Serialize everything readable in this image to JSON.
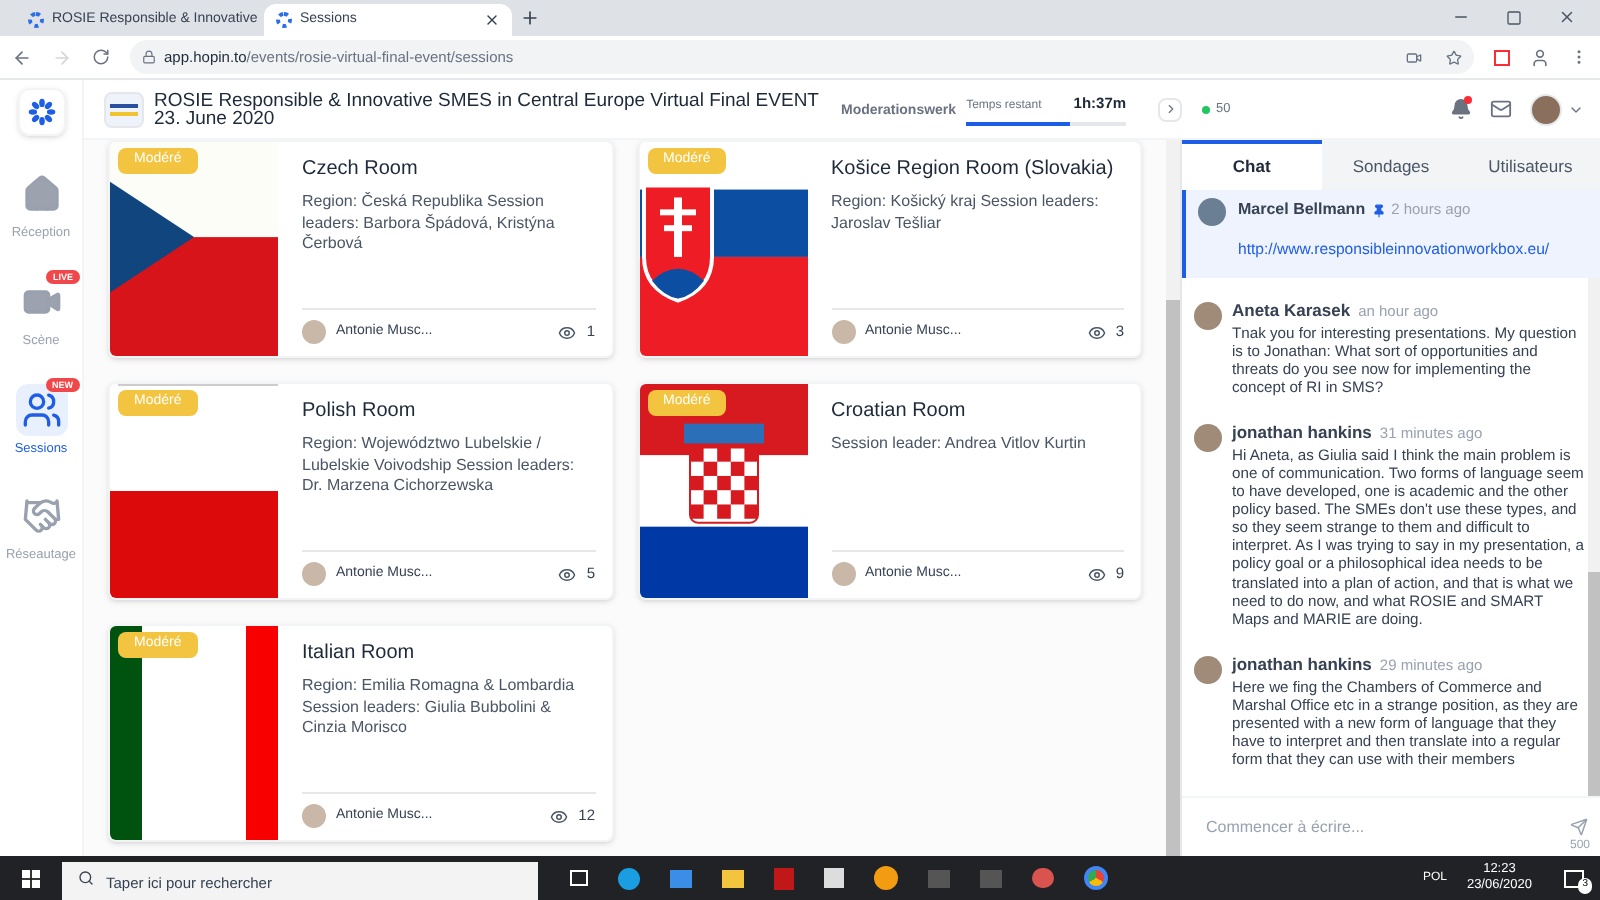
{
  "browser": {
    "tabs": [
      {
        "title": "ROSIE Responsible & Innovative",
        "selected": false
      },
      {
        "title": "Sessions",
        "selected": true
      }
    ],
    "url_host": "app.hopin.to",
    "url_path": "/events/rosie-virtual-final-event/sessions"
  },
  "header": {
    "title": "ROSIE Responsible & Innovative SMES in Central Europe Virtual Final EVENT",
    "date": "23. June 2020",
    "segment": "Moderationswerk",
    "timer_label": "Temps restant",
    "timer": "1h:37m",
    "level": 0.65,
    "online_count": "50",
    "has_notification": true
  },
  "sidebar": {
    "items": [
      {
        "label": "Réception",
        "selected": false
      },
      {
        "label": "Scène",
        "badge": "LIVE",
        "selected": false
      },
      {
        "label": "Sessions",
        "badge": "NEW",
        "selected": true
      },
      {
        "label": "Réseautage",
        "selected": false
      }
    ]
  },
  "sessions": [
    {
      "title": "Czech Room",
      "description": "Region: Česká Republika Session leaders: Barbora Špádová, Kristýna Čerbová",
      "kind": "czech",
      "badge": "Modéré",
      "host": "Antonie Musc...",
      "viewers": "1"
    },
    {
      "title": "Košice Region Room (Slovakia)",
      "description": "Region: Košický kraj Session leaders: Jaroslav Tešliar",
      "kind": "slovakia",
      "badge": "Modéré",
      "host": "Antonie Musc...",
      "viewers": "3"
    },
    {
      "title": "Polish Room",
      "description": "Region: Województwo Lubelskie / Lubelskie Voivodship Session leaders: Dr. Marzena Cichorzewska",
      "kind": "poland",
      "badge": "Modéré",
      "host": "Antonie Musc...",
      "viewers": "5"
    },
    {
      "title": "Croatian Room",
      "description": "Session leader: Andrea Vitlov Kurtin",
      "kind": "croatia",
      "badge": "Modéré",
      "host": "Antonie Musc...",
      "viewers": "9"
    },
    {
      "title": "Italian Room",
      "description": "Region: Emilia Romagna & Lombardia Session leaders: Giulia Bubbolini & Cinzia Morisco",
      "kind": "italy",
      "badge": "Modéré",
      "host": "Antonie Musc...",
      "viewers": "12"
    }
  ],
  "chat": {
    "tabs": [
      {
        "label": "Chat",
        "selected": true
      },
      {
        "label": "Sondages",
        "selected": false
      },
      {
        "label": "Utilisateurs",
        "selected": false
      }
    ],
    "pinned": {
      "author": "Marcel Bellmann",
      "time": "2 hours ago",
      "text": "http://www.responsibleinnovationworkbox.eu/"
    },
    "messages": [
      {
        "author": "Aneta Karasek",
        "time": "an hour ago",
        "text": "Tnak you for interesting presentations. My question is to Jonathan: What sort of opportunities and threats do you see now for implementing the concept of RI in SMS?"
      },
      {
        "author": "jonathan hankins",
        "time": "31 minutes ago",
        "text": "Hi Aneta, as Giulia said I think the main problem is one of communication. Two forms of language seem to have developed, one is academic and the other policy based. The SMEs don't use these types, and so they seem strange to them and difficult to interpret. As I was trying to say in my presentation, a policy goal or a philosophical idea needs to be translated into a plan of action, and that is what we need to do now, and what ROSIE and SMART Maps and MARIE are doing."
      },
      {
        "author": "jonathan hankins",
        "time": "29 minutes ago",
        "text": "Here we fing the Chambers of Commerce and Marshal Office etc in a strange position, as they are presented with a new form of language that they have to interpret and then translate into a regular form that they can use with their members"
      }
    ],
    "placeholder": "Commencer à écrire...",
    "counter": "500"
  },
  "taskbar": {
    "search_placeholder": "Taper ici pour rechercher",
    "language": "POL",
    "time": "12:23",
    "date": "23/06/2020",
    "notifications": "3"
  }
}
